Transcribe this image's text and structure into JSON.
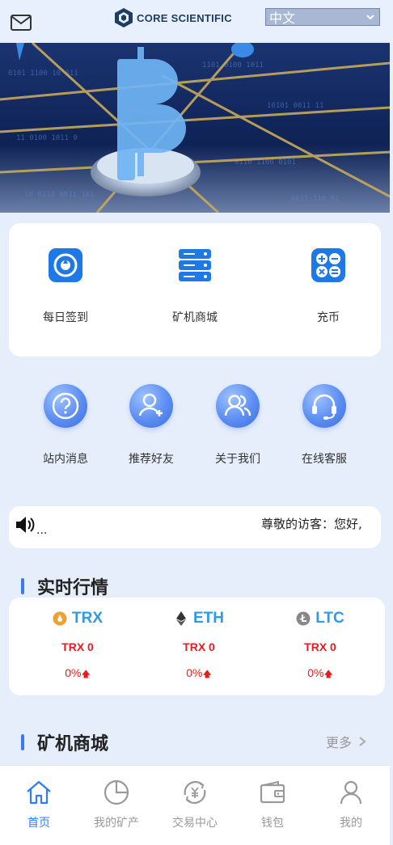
{
  "header": {
    "brand": "CORE SCIENTIFIC",
    "language": "中文"
  },
  "quick_actions": [
    {
      "label": "每日签到",
      "icon": "gift-wheel-icon"
    },
    {
      "label": "矿机商城",
      "icon": "server-icon"
    },
    {
      "label": "充币",
      "icon": "calculator-icon"
    }
  ],
  "circle_actions": [
    {
      "label": "站内消息",
      "icon": "question-icon"
    },
    {
      "label": "推荐好友",
      "icon": "add-user-icon"
    },
    {
      "label": "关于我们",
      "icon": "users-icon"
    },
    {
      "label": "在线客服",
      "icon": "headset-icon"
    }
  ],
  "notice": {
    "dots": "...",
    "text": "尊敬的访客：您好,"
  },
  "market": {
    "title": "实时行情",
    "coins": [
      {
        "name": "TRX",
        "price": "TRX 0",
        "change": "0%",
        "icon": "trx-icon",
        "color": "#f0a030"
      },
      {
        "name": "ETH",
        "price": "TRX 0",
        "change": "0%",
        "icon": "eth-icon",
        "color": "#333333"
      },
      {
        "name": "LTC",
        "price": "TRX 0",
        "change": "0%",
        "icon": "ltc-icon",
        "color": "#888888"
      }
    ]
  },
  "shop": {
    "title": "矿机商城",
    "more": "更多"
  },
  "tabbar": [
    {
      "label": "首页",
      "icon": "home-icon",
      "active": true
    },
    {
      "label": "我的矿产",
      "icon": "pie-chart-icon",
      "active": false
    },
    {
      "label": "交易中心",
      "icon": "yuan-exchange-icon",
      "active": false
    },
    {
      "label": "钱包",
      "icon": "wallet-icon",
      "active": false
    },
    {
      "label": "我的",
      "icon": "user-icon",
      "active": false
    }
  ],
  "colors": {
    "accent": "#2f7cf6",
    "price_red": "#e02020",
    "coin_blue": "#2e9ae8",
    "page_bg": "#e6eefc"
  }
}
